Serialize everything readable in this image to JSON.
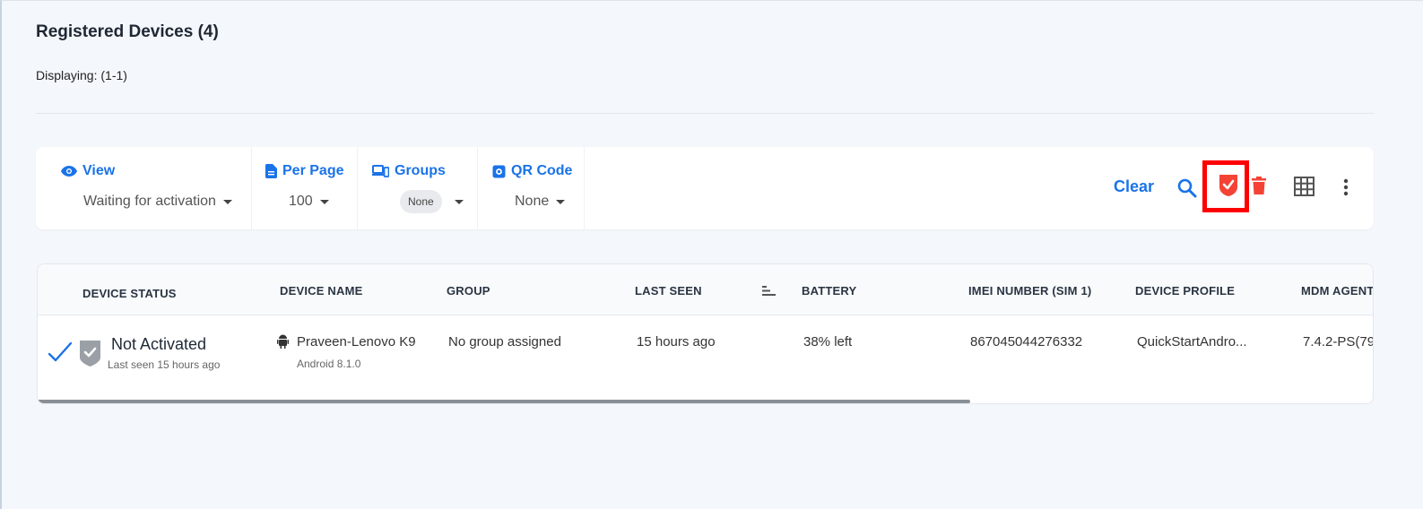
{
  "header": {
    "title": "Registered Devices (4)",
    "displaying": "Displaying: (1-1)"
  },
  "toolbar": {
    "filters": [
      {
        "label": "View",
        "icon": "eye-icon",
        "value": "Waiting for activation"
      },
      {
        "label": "Per Page",
        "icon": "document-icon",
        "value": "100"
      },
      {
        "label": "Groups",
        "icon": "devices-icon",
        "value": "None"
      },
      {
        "label": "QR Code",
        "icon": "qr-code-icon",
        "value": "None"
      }
    ],
    "clear_label": "Clear",
    "icons": [
      "search-icon",
      "shield-check-icon",
      "trash-icon",
      "grid-icon",
      "more-vert-icon"
    ]
  },
  "table": {
    "columns": [
      "DEVICE STATUS",
      "DEVICE NAME",
      "GROUP",
      "LAST SEEN",
      "BATTERY",
      "IMEI NUMBER (SIM 1)",
      "DEVICE PROFILE",
      "MDM AGENT"
    ],
    "rows": [
      {
        "status": "Not Activated",
        "status_sub": "Last seen 15 hours ago",
        "device_name": "Praveen-Lenovo K9",
        "os": "Android 8.1.0",
        "group": "No group assigned",
        "last_seen": "15 hours ago",
        "battery": "38% left",
        "imei": "867045044276332",
        "profile": "QuickStartAndro...",
        "agent": "7.4.2-PS(79..."
      }
    ]
  },
  "colors": {
    "accent": "#1a73e8",
    "danger": "#f44336",
    "highlight": "#ff0000"
  }
}
